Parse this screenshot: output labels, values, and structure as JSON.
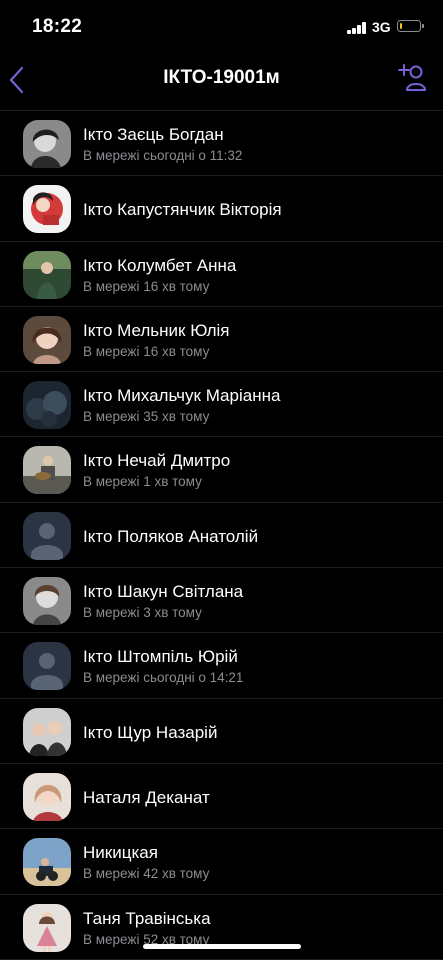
{
  "status_bar": {
    "time": "18:22",
    "network": "3G",
    "battery_level": 0.12,
    "battery_color": "#f5c518"
  },
  "header": {
    "title": "ІКТО-19001м",
    "back_icon": "chevron-left-icon",
    "add_icon": "add-participant-icon",
    "accent_color": "#7b5fd6"
  },
  "members": [
    {
      "name": "Ікто Заєць Богдан",
      "status": "В мережі сьогодні о 11:32",
      "avatar": "photo"
    },
    {
      "name": "Ікто Капустянчик Вікторія",
      "status": "",
      "avatar": "photo"
    },
    {
      "name": "Ікто Колумбет Анна",
      "status": "В мережі 16 хв тому",
      "avatar": "photo"
    },
    {
      "name": "Ікто Мельник Юлія",
      "status": "В мережі 16 хв тому",
      "avatar": "photo"
    },
    {
      "name": "Ікто Михальчук Маріанна",
      "status": "В мережі 35 хв тому",
      "avatar": "photo"
    },
    {
      "name": "Ікто Нечай Дмитро",
      "status": "В мережі 1 хв тому",
      "avatar": "photo"
    },
    {
      "name": "Ікто Поляков Анатолій",
      "status": "",
      "avatar": "placeholder"
    },
    {
      "name": "Ікто Шакун Світлана",
      "status": "В мережі 3 хв тому",
      "avatar": "photo"
    },
    {
      "name": "Ікто Штомпіль Юрій",
      "status": "В мережі сьогодні о 14:21",
      "avatar": "placeholder"
    },
    {
      "name": "Ікто Щур Назарій",
      "status": "",
      "avatar": "photo"
    },
    {
      "name": "Наталя Деканат",
      "status": "",
      "avatar": "photo"
    },
    {
      "name": "Никицкая",
      "status": "В мережі 42 хв тому",
      "avatar": "photo"
    },
    {
      "name": "Таня Травінська",
      "status": "В мережі 52 хв тому",
      "avatar": "photo"
    }
  ]
}
